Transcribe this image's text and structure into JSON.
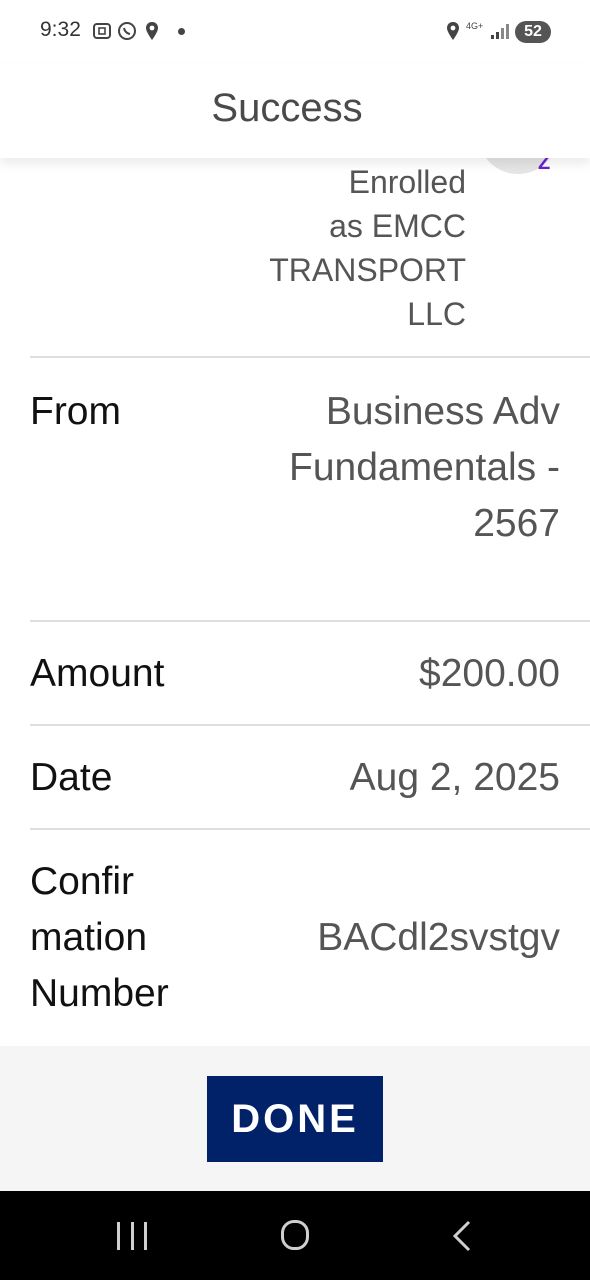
{
  "status_bar": {
    "time": "9:32",
    "network": "4G+",
    "battery": "52",
    "icons": [
      "screenshot-icon",
      "whatsapp-icon",
      "location-icon",
      "notification-dot",
      "location-icon",
      "signal-icon",
      "battery-icon"
    ]
  },
  "header": {
    "title": "Success"
  },
  "recipient": {
    "enrolled_line1": "Enrolled",
    "enrolled_line2": "as EMCC",
    "enrolled_line3": "TRANSPORT",
    "enrolled_line4": "LLC",
    "badge_letter": "Z"
  },
  "details": {
    "from_label": "From",
    "from_value_line1": "Business Adv",
    "from_value_line2": "Fundamentals -",
    "from_value_line3": "2567",
    "amount_label": "Amount",
    "amount_value": "$200.00",
    "date_label": "Date",
    "date_value": "Aug 2, 2025",
    "confirmation_label_line1": "Confir",
    "confirmation_label_line2": "mation",
    "confirmation_label_line3": "Number",
    "confirmation_value": "BACdl2svstgv"
  },
  "footer": {
    "done_label": "DONE"
  },
  "colors": {
    "button": "#012169",
    "zelle": "#6d1ed4",
    "label": "#111111",
    "value": "#555555"
  }
}
